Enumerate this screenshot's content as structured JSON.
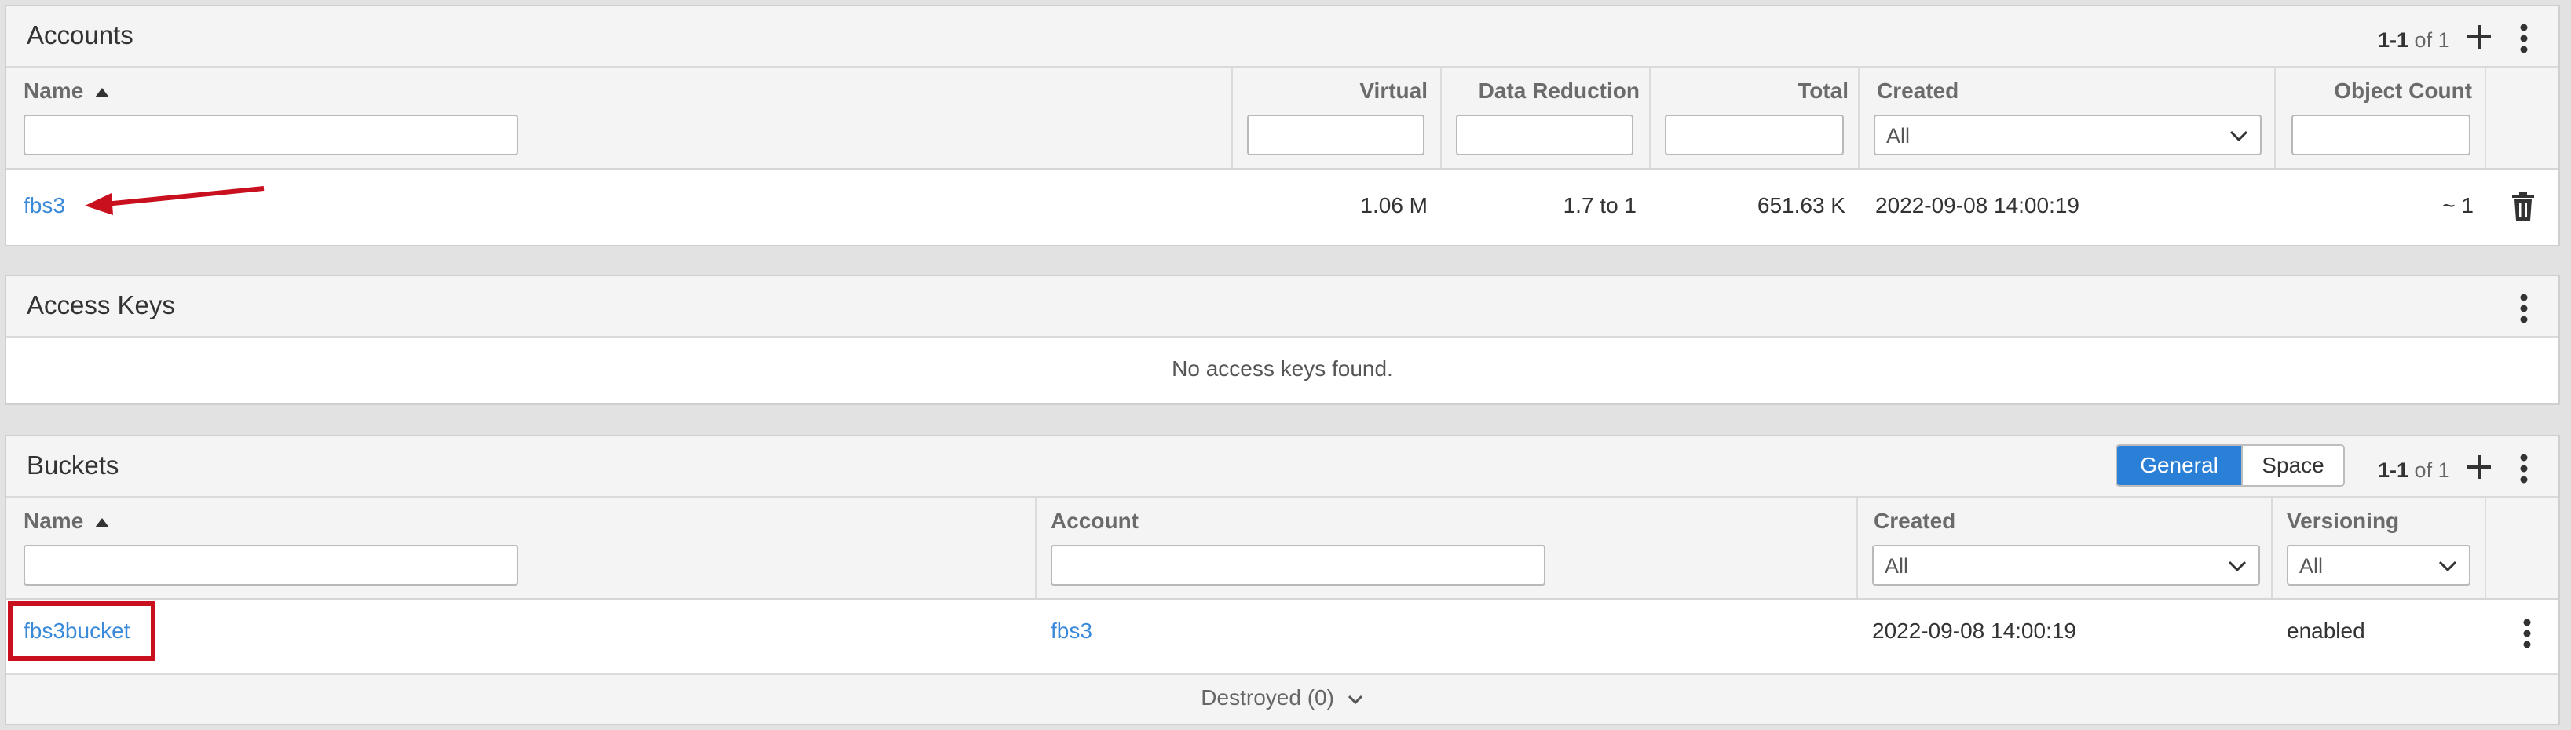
{
  "accounts": {
    "title": "Accounts",
    "pager": {
      "range": "1-1",
      "of": "of 1"
    },
    "columns": {
      "name": "Name",
      "virtual": "Virtual",
      "data_reduction": "Data Reduction",
      "total": "Total",
      "created": "Created",
      "object_count": "Object Count"
    },
    "created_filter": "All",
    "rows": [
      {
        "name": "fbs3",
        "virtual": "1.06 M",
        "data_reduction": "1.7 to 1",
        "total": "651.63 K",
        "created": "2022-09-08 14:00:19",
        "object_count": "~ 1"
      }
    ]
  },
  "access_keys": {
    "title": "Access Keys",
    "empty_message": "No access keys found."
  },
  "buckets": {
    "title": "Buckets",
    "view_toggle": {
      "general": "General",
      "space": "Space",
      "active": "General"
    },
    "pager": {
      "range": "1-1",
      "of": "of 1"
    },
    "columns": {
      "name": "Name",
      "account": "Account",
      "created": "Created",
      "versioning": "Versioning"
    },
    "created_filter": "All",
    "versioning_filter": "All",
    "rows": [
      {
        "name": "fbs3bucket",
        "account": "fbs3",
        "created": "2022-09-08 14:00:19",
        "versioning": "enabled"
      }
    ],
    "destroyed_label": "Destroyed (0)"
  },
  "annotation_colors": {
    "arrow": "#c8101e",
    "highlight_box": "#c8101e"
  },
  "colors": {
    "link": "#3b8ad9",
    "accent": "#2a7fd6"
  }
}
